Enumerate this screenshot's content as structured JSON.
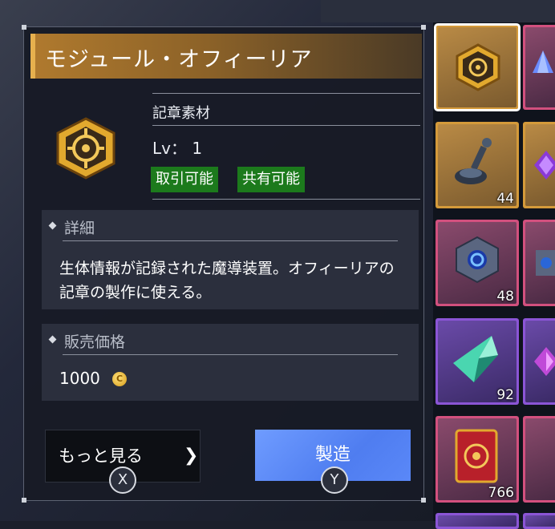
{
  "panel": {
    "title": "モジュール・オフィーリア",
    "category": "記章素材",
    "level": "Lv： 1",
    "tags": [
      "取引可能",
      "共有可能"
    ],
    "detail_title": "詳細",
    "description": "生体情報が記録された魔導装置。オフィーリアの記章の製作に使える。",
    "price_title": "販売価格",
    "price": "1000",
    "more_button": "もっと見る",
    "more_key": "X",
    "craft_button": "製造",
    "craft_key": "Y"
  },
  "inventory": {
    "quantities": [
      "44",
      "48",
      "92",
      "766"
    ]
  },
  "icons": {
    "item": "emblem-icon",
    "coin": "coin-icon",
    "chevron": "chevron-down-icon"
  },
  "colors": {
    "title_gold": "#b07a2e",
    "tag_green": "#1c7a1c",
    "craft_blue": "#5a88f8",
    "rarity_gold": "#d49a3a",
    "rarity_pink": "#d2507e",
    "rarity_purple": "#8b55d6"
  }
}
